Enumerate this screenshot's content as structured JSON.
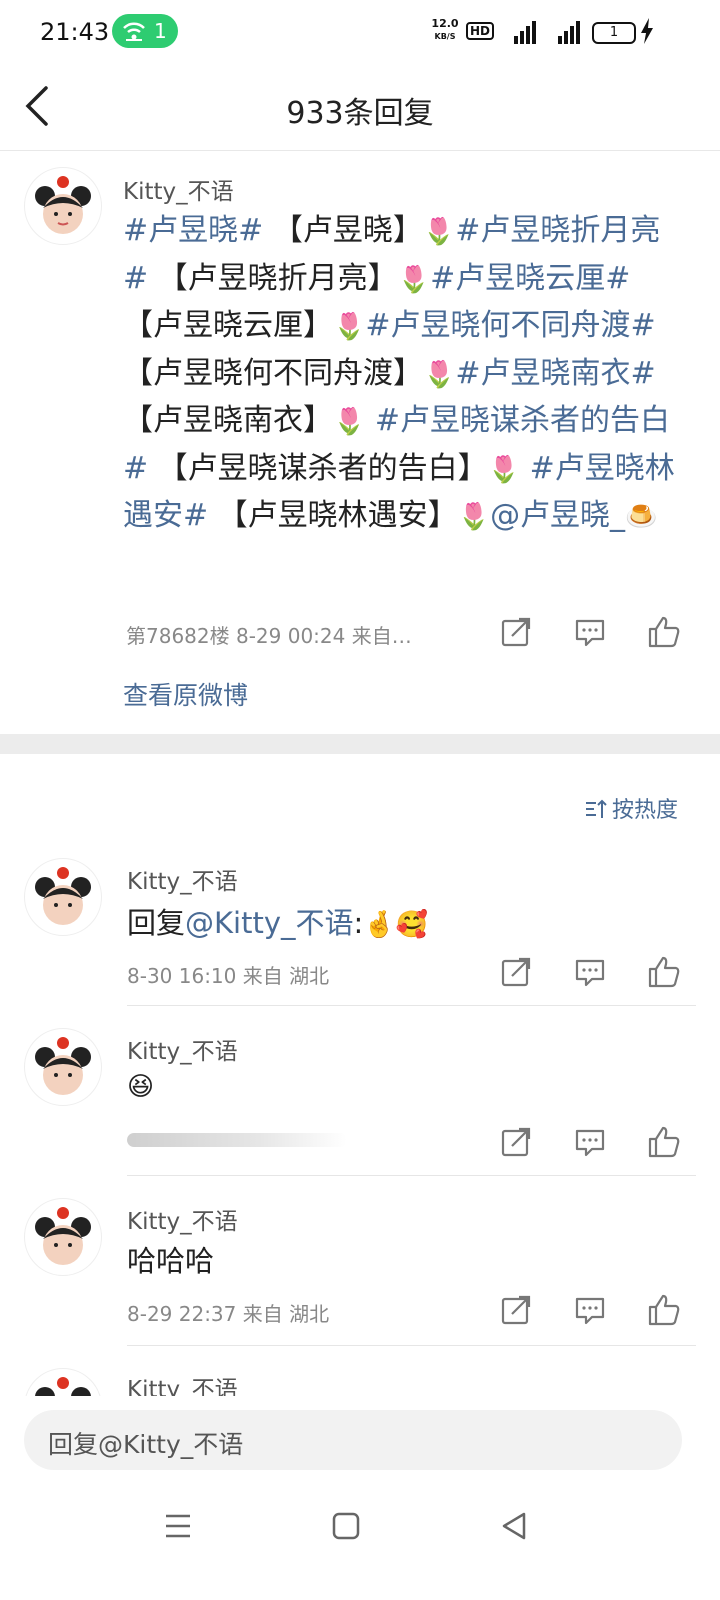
{
  "status_bar": {
    "time": "21:43",
    "wifi_count": "1",
    "speed_top": "12.0",
    "speed_unit": "KB/S",
    "hd": "HD",
    "battery": "1"
  },
  "header": {
    "title": "933条回复"
  },
  "post": {
    "username": "Kitty_不语",
    "body": [
      {
        "t": "tag",
        "v": "#卢昱晓#"
      },
      {
        "t": "text",
        "v": " 【卢昱晓】"
      },
      {
        "t": "emoji",
        "v": "🌷"
      },
      {
        "t": "tag",
        "v": "#卢昱晓折月亮#"
      },
      {
        "t": "text",
        "v": " 【卢昱晓折月亮】"
      },
      {
        "t": "emoji",
        "v": "🌷"
      },
      {
        "t": "tag",
        "v": "#卢昱晓云厘#"
      },
      {
        "t": "text",
        "v": " 【卢昱晓云厘】"
      },
      {
        "t": "emoji",
        "v": "🌷"
      },
      {
        "t": "tag",
        "v": "#卢昱晓何不同舟渡#"
      },
      {
        "t": "text",
        "v": " 【卢昱晓何不同舟渡】"
      },
      {
        "t": "emoji",
        "v": "🌷"
      },
      {
        "t": "tag",
        "v": "#卢昱晓南衣#"
      },
      {
        "t": "text",
        "v": " 【卢昱晓南衣】"
      },
      {
        "t": "emoji",
        "v": "🌷"
      },
      {
        "t": "tag",
        "v": " #卢昱晓谋杀者的告白#"
      },
      {
        "t": "text",
        "v": " 【卢昱晓谋杀者的告白】"
      },
      {
        "t": "emoji",
        "v": "🌷"
      },
      {
        "t": "tag",
        "v": " #卢昱晓林遇安#"
      },
      {
        "t": "text",
        "v": " 【卢昱晓林遇安】"
      },
      {
        "t": "emoji",
        "v": "🌷"
      },
      {
        "t": "mention",
        "v": "@卢昱晓_"
      },
      {
        "t": "emoji",
        "v": "🍮"
      }
    ],
    "meta": "第78682楼  8-29 00:24  来自…",
    "view_original": "查看原微博"
  },
  "sort_label": "按热度",
  "comments": [
    {
      "username": "Kitty_不语",
      "prefix": "回复",
      "mention": "@Kitty_不语",
      "suffix": ":",
      "emojis": "🤞🥰",
      "meta": "8-30 16:10  来自 湖北"
    },
    {
      "username": "Kitty_不语",
      "emojis": "😆",
      "meta": ""
    },
    {
      "username": "Kitty_不语",
      "text": "哈哈哈",
      "meta": "8-29 22:37  来自 湖北"
    },
    {
      "username": "Kitty_不语"
    }
  ],
  "reply_input": {
    "placeholder": "回复@Kitty_不语"
  },
  "colors": {
    "link": "#4a6b95",
    "wifi_pill": "#2ecc71"
  },
  "icons": [
    "back-arrow-icon",
    "share-icon",
    "comment-icon",
    "like-icon",
    "sort-icon",
    "menu-icon",
    "home-icon",
    "back-triangle-icon"
  ]
}
